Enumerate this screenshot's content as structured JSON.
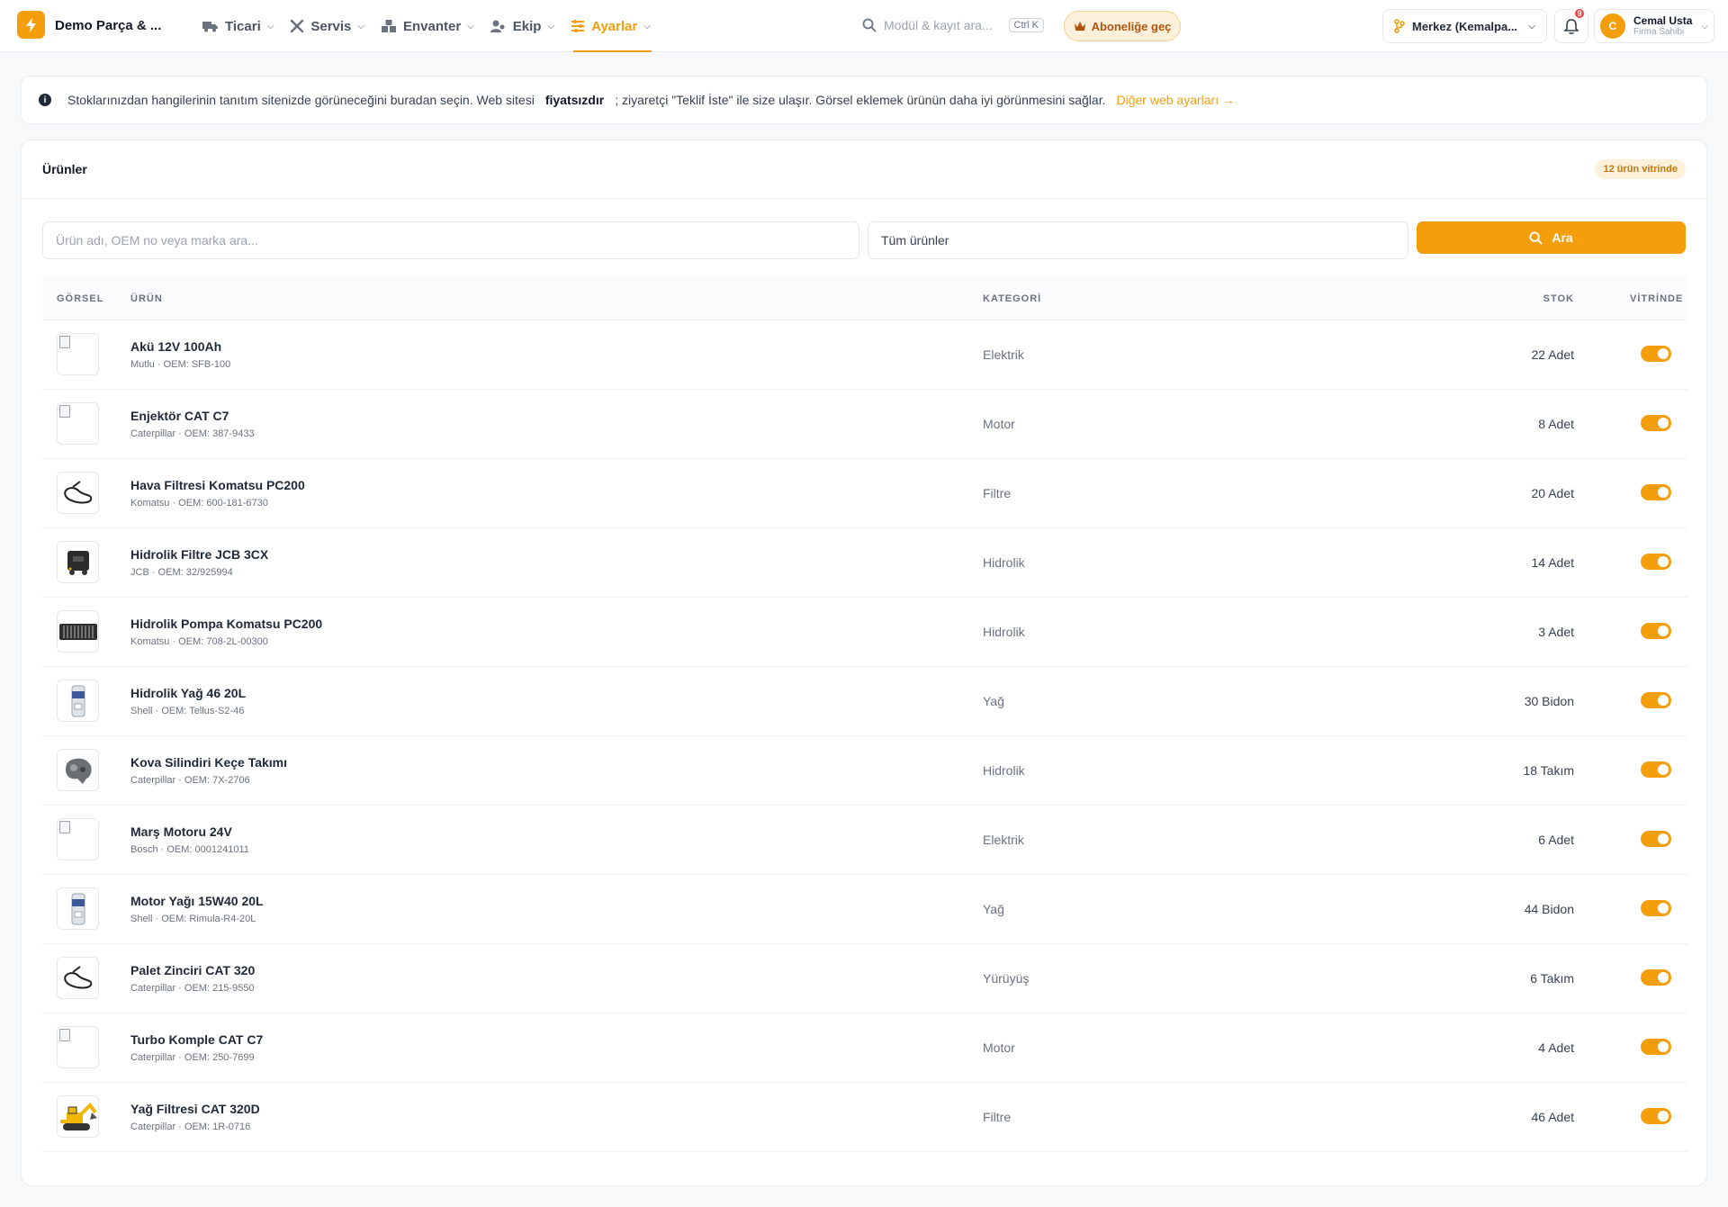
{
  "header": {
    "company": "Demo Parça & ...",
    "nav": [
      {
        "label": "Ticari",
        "icon": "truck-icon"
      },
      {
        "label": "Servis",
        "icon": "tools-icon"
      },
      {
        "label": "Envanter",
        "icon": "warehouse-icon"
      },
      {
        "label": "Ekip",
        "icon": "users-icon"
      },
      {
        "label": "Ayarlar",
        "icon": "sliders-icon",
        "active": true
      }
    ],
    "search_placeholder": "Modül & kayıt ara...",
    "search_shortcut": "Ctrl K",
    "upgrade_label": "Aboneliğe geç",
    "branch": "Merkez (Kemalpa...",
    "notifications": "9",
    "user": {
      "initial": "C",
      "name": "Cemal Usta",
      "role": "Firma Sahibi"
    }
  },
  "banner": {
    "text_before": "Stoklarınızdan hangilerinin tanıtım sitenizde görüneceğini buradan seçin. Web sitesi",
    "emphasis": "fiyatsızdır",
    "text_after": "; ziyaretçi \"Teklif İste\" ile size ulaşır. Görsel eklemek ürünün daha iyi görünmesini sağlar.",
    "link": "Diğer web ayarları →"
  },
  "products": {
    "title": "Ürünler",
    "badge": "12 ürün vitrinde",
    "search_placeholder": "Ürün adı, OEM no veya marka ara...",
    "filter_value": "Tüm ürünler",
    "search_button": "Ara",
    "columns": {
      "image": "GÖRSEL",
      "product": "ÜRÜN",
      "category": "KATEGORİ",
      "stock": "STOK",
      "showcase": "VİTRİNDE"
    },
    "rows": [
      {
        "name": "Akü 12V 100Ah",
        "sub": "Mutlu · OEM: SFB-100",
        "category": "Elektrik",
        "stock": "22 Adet",
        "thumb": "broken",
        "showcase": true
      },
      {
        "name": "Enjektör CAT C7",
        "sub": "Caterpillar · OEM: 387-9433",
        "category": "Motor",
        "stock": "8 Adet",
        "thumb": "broken",
        "showcase": true
      },
      {
        "name": "Hava Filtresi Komatsu PC200",
        "sub": "Komatsu · OEM: 600-181-6730",
        "category": "Filtre",
        "stock": "20 Adet",
        "thumb": "belt",
        "showcase": true
      },
      {
        "name": "Hidrolik Filtre JCB 3CX",
        "sub": "JCB · OEM: 32/925994",
        "category": "Hidrolik",
        "stock": "14 Adet",
        "thumb": "case",
        "showcase": true
      },
      {
        "name": "Hidrolik Pompa Komatsu PC200",
        "sub": "Komatsu · OEM: 708-2L-00300",
        "category": "Hidrolik",
        "stock": "3 Adet",
        "thumb": "toolset",
        "showcase": true
      },
      {
        "name": "Hidrolik Yağ 46 20L",
        "sub": "Shell · OEM: Tellus-S2-46",
        "category": "Yağ",
        "stock": "30 Bidon",
        "thumb": "filter",
        "showcase": true
      },
      {
        "name": "Kova Silindiri Keçe Takımı",
        "sub": "Caterpillar · OEM: 7X-2706",
        "category": "Hidrolik",
        "stock": "18 Takım",
        "thumb": "engine",
        "showcase": true
      },
      {
        "name": "Marş Motoru 24V",
        "sub": "Bosch · OEM: 0001241011",
        "category": "Elektrik",
        "stock": "6 Adet",
        "thumb": "broken",
        "showcase": true
      },
      {
        "name": "Motor Yağı 15W40 20L",
        "sub": "Shell · OEM: Rimula-R4-20L",
        "category": "Yağ",
        "stock": "44 Bidon",
        "thumb": "filter",
        "showcase": true
      },
      {
        "name": "Palet Zinciri CAT 320",
        "sub": "Caterpillar · OEM: 215-9550",
        "category": "Yürüyüş",
        "stock": "6 Takım",
        "thumb": "belt",
        "showcase": true
      },
      {
        "name": "Turbo Komple CAT C7",
        "sub": "Caterpillar · OEM: 250-7699",
        "category": "Motor",
        "stock": "4 Adet",
        "thumb": "broken",
        "showcase": true
      },
      {
        "name": "Yağ Filtresi CAT 320D",
        "sub": "Caterpillar · OEM: 1R-0716",
        "category": "Filtre",
        "stock": "46 Adet",
        "thumb": "excavator",
        "showcase": true
      }
    ]
  },
  "colors": {
    "accent": "#f59e0b",
    "accent_soft": "#fdf1dc",
    "text": "#1f2937",
    "muted": "#6b7280"
  }
}
